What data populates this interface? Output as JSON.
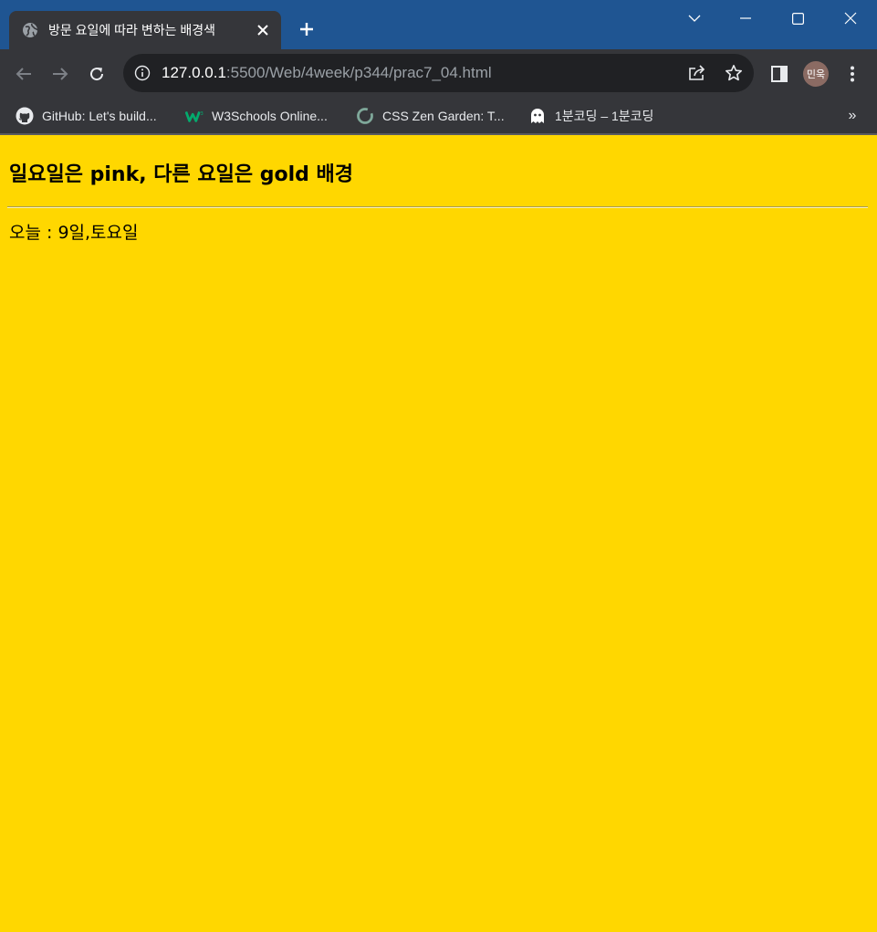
{
  "browser": {
    "tab": {
      "title": "방문 요일에 따라 변하는 배경색",
      "favicon": "globe-icon",
      "close": "close-icon"
    },
    "new_tab_icon": "plus-icon",
    "window_controls": [
      "tab-search-icon",
      "minimize-icon",
      "maximize-icon",
      "close-icon"
    ],
    "address": {
      "host": "127.0.0.1",
      "rest": ":5500/Web/4week/p344/prac7_04.html"
    },
    "profile_initials": "민욱"
  },
  "bookmarks": {
    "items": [
      {
        "label": "GitHub: Let's build...",
        "icon": "github-icon"
      },
      {
        "label": "W3Schools Online...",
        "icon": "w3schools-icon"
      },
      {
        "label": "CSS Zen Garden: T...",
        "icon": "zen-garden-icon"
      },
      {
        "label": "1분코딩 – 1분코딩",
        "icon": "ghost-icon"
      }
    ],
    "more_label": "»"
  },
  "page": {
    "heading": "일요일은 pink, 다른 요일은 gold 배경",
    "today_text": "오늘 : 9일,토요일",
    "background": "#ffd700"
  },
  "theme": {
    "titlebar": "#1f5592",
    "toolbar": "#35363a",
    "omnibox": "#202124"
  }
}
